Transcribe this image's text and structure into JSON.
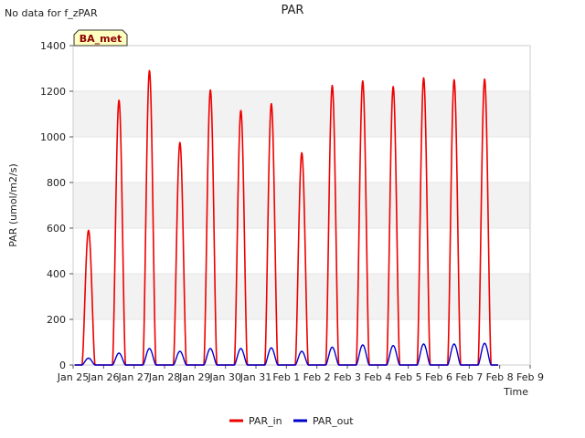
{
  "corner_note": "No data for f_zPAR",
  "chart_data": {
    "type": "line",
    "title": "PAR",
    "xlabel": "Time",
    "ylabel": "PAR (umol/m2/s)",
    "ylim": [
      0,
      1400
    ],
    "xlim": [
      0,
      15
    ],
    "yticks": [
      0,
      200,
      400,
      600,
      800,
      1000,
      1200,
      1400
    ],
    "x_tick_labels": [
      "Jan 25",
      "Jan 26",
      "Jan 27",
      "Jan 28",
      "Jan 29",
      "Jan 30",
      "Jan 31",
      "Feb 1",
      "Feb 2",
      "Feb 3",
      "Feb 4",
      "Feb 5",
      "Feb 6",
      "Feb 7",
      "Feb 8",
      "Feb 9"
    ],
    "grid": "horizontal bands",
    "badge": "BA_met",
    "legend_position": "bottom-center",
    "colors": {
      "PAR_in": "#ee0000",
      "PAR_out": "#0000cc",
      "badge_bg": "#ffffc0",
      "badge_text": "#8b0000",
      "band": "#f2f2f2"
    },
    "series": [
      {
        "name": "PAR_in",
        "color": "#ee0000",
        "x_start_date": "Jan 25",
        "days": [
          {
            "day": 0,
            "peak": 590
          },
          {
            "day": 1,
            "peak": 1160
          },
          {
            "day": 2,
            "peak": 1290
          },
          {
            "day": 3,
            "peak": 975
          },
          {
            "day": 4,
            "peak": 1205
          },
          {
            "day": 5,
            "peak": 1115
          },
          {
            "day": 6,
            "peak": 1145
          },
          {
            "day": 7,
            "peak": 930
          },
          {
            "day": 8,
            "peak": 1225
          },
          {
            "day": 9,
            "peak": 1245
          },
          {
            "day": 10,
            "peak": 1220
          },
          {
            "day": 11,
            "peak": 1258
          },
          {
            "day": 12,
            "peak": 1250
          },
          {
            "day": 13,
            "peak": 1253
          }
        ]
      },
      {
        "name": "PAR_out",
        "color": "#0000cc",
        "x_start_date": "Jan 25",
        "days": [
          {
            "day": 0,
            "peak": 30
          },
          {
            "day": 1,
            "peak": 52
          },
          {
            "day": 2,
            "peak": 72
          },
          {
            "day": 3,
            "peak": 60
          },
          {
            "day": 4,
            "peak": 72
          },
          {
            "day": 5,
            "peak": 72
          },
          {
            "day": 6,
            "peak": 75
          },
          {
            "day": 7,
            "peak": 60
          },
          {
            "day": 8,
            "peak": 78
          },
          {
            "day": 9,
            "peak": 88
          },
          {
            "day": 10,
            "peak": 85
          },
          {
            "day": 11,
            "peak": 92
          },
          {
            "day": 12,
            "peak": 92
          },
          {
            "day": 13,
            "peak": 95
          }
        ]
      }
    ]
  }
}
